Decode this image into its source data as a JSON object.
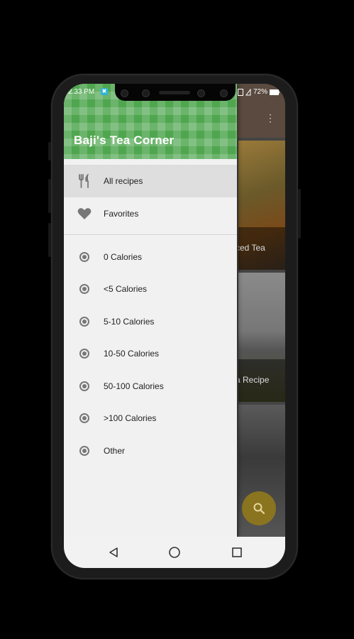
{
  "status_bar": {
    "time": "2:33 PM",
    "battery": "72%"
  },
  "drawer": {
    "title": "Baji's Tea Corner",
    "primary_items": [
      {
        "label": "All recipes",
        "icon": "fork-knife-icon",
        "active": true
      },
      {
        "label": "Favorites",
        "icon": "heart-icon",
        "active": false
      }
    ],
    "category_items": [
      {
        "label": "0 Calories",
        "icon": "radio-icon"
      },
      {
        "label": "<5 Calories",
        "icon": "radio-icon"
      },
      {
        "label": "5-10 Calories",
        "icon": "radio-icon"
      },
      {
        "label": "10-50 Calories",
        "icon": "radio-icon"
      },
      {
        "label": "50-100 Calories",
        "icon": "radio-icon"
      },
      {
        "label": ">100 Calories",
        "icon": "radio-icon"
      },
      {
        "label": "Other",
        "icon": "radio-icon"
      }
    ]
  },
  "background": {
    "card_captions": [
      "ced Tea",
      "a Recipe"
    ],
    "fab_icon": "search-icon"
  },
  "colors": {
    "header_green": "#4fa64f",
    "fab": "#8a7420",
    "active_row": "#dedede"
  }
}
